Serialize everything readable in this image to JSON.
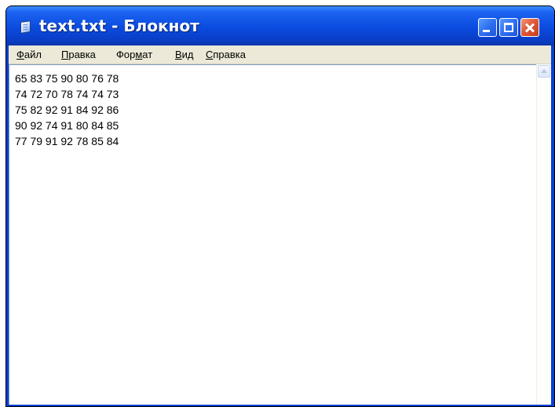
{
  "window": {
    "title": "text.txt - Блокнот",
    "controls": {
      "minimize": "minimize",
      "maximize": "maximize",
      "close": "close"
    }
  },
  "menu": {
    "items": [
      {
        "mnemonic": "Ф",
        "rest": "айл"
      },
      {
        "mnemonic": "П",
        "rest": "равка"
      },
      {
        "before": "Фор",
        "mnemonic": "м",
        "rest": "ат"
      },
      {
        "mnemonic": "В",
        "rest": "ид"
      },
      {
        "mnemonic": "С",
        "rest": "правка"
      }
    ]
  },
  "document": {
    "lines": [
      "65 83 75 90 80 76 78",
      "74 72 70 78 74 74 73",
      "75 82 92 91 84 92 86",
      "90 92 74 91 80 84 85",
      "77 79 91 92 78 85 84"
    ]
  },
  "icons": {
    "app": "notepad-icon",
    "scroll_up": "scroll-up-arrow-icon"
  },
  "colors": {
    "title_bar": "#0b4bdf",
    "close_button": "#e05a3a",
    "menu_bar": "#ece9d8",
    "edit_background": "#ffffff"
  }
}
